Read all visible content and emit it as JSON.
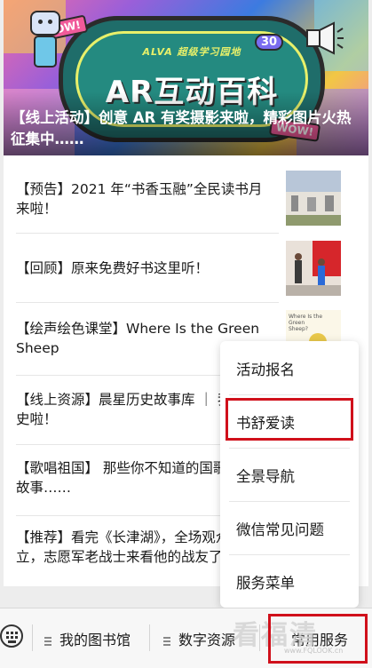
{
  "banner": {
    "subtitle": "ALVA 超级学习园地",
    "title": "AR互动百科",
    "wow_label": "WOW!",
    "tag": "30",
    "caption": "【线上活动】创意 AR 有奖摄影来啦，精彩图片火热征集中……"
  },
  "articles": [
    {
      "text": "【预告】2021 年“书香玉融”全民读书月来啦！"
    },
    {
      "text": "【回顾】原来免费好书这里听！"
    },
    {
      "text": "【绘声绘色课堂】Where Is the Green Sheep"
    },
    {
      "text": "【线上资源】晨星历史故事库 ｜ 我要学历史啦！"
    },
    {
      "text": "【歌唱祖国】 那些你不知道的国歌背后的故事……"
    },
    {
      "text": "【推荐】看完《长津湖》，全场观众起立伫立，志愿军老战士来看他的战友了……"
    }
  ],
  "thumb3_text": "Where Is the Green Sheep?",
  "popup_menu": {
    "items": [
      "活动报名",
      "书舒爱读",
      "全景导航",
      "微信常见问题",
      "服务菜单"
    ],
    "highlighted": "书舒爱读"
  },
  "bottom_menu": {
    "tabs": [
      "我的图书馆",
      "数字资源",
      "常用服务"
    ],
    "highlighted": "常用服务"
  },
  "watermark": {
    "main": "看福清",
    "sub": "www.FQLOOK.cn"
  },
  "colors": {
    "highlight_box": "#d0101b"
  }
}
